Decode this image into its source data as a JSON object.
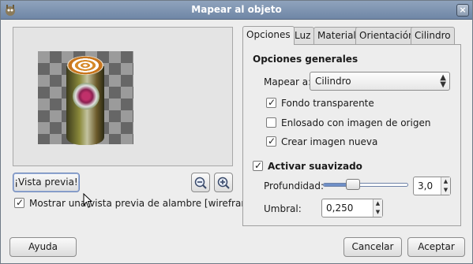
{
  "window": {
    "title": "Mapear al objeto",
    "close_glyph": "×"
  },
  "preview": {
    "button_label": "¡Vista previa!",
    "wireframe_checkbox": {
      "label": "Mostrar una vista previa de alambre [wireframe]",
      "checked": true
    },
    "zoom_out_icon": "zoom-out-icon",
    "zoom_in_icon": "zoom-in-icon"
  },
  "tabs": [
    {
      "label": "Opciones",
      "active": true
    },
    {
      "label": "Luz"
    },
    {
      "label": "Material"
    },
    {
      "label": "Orientación"
    },
    {
      "label": "Cilindro"
    }
  ],
  "options": {
    "general_title": "Opciones generales",
    "map_label": "Mapear a:",
    "map_value": "Cilindro",
    "transparent_bg": {
      "label": "Fondo transparente",
      "checked": true
    },
    "tile_source": {
      "label": "Enlosado con imagen de origen",
      "checked": false
    },
    "new_image": {
      "label": "Crear imagen nueva",
      "checked": true
    },
    "antialias": {
      "label": "Activar suavizado",
      "checked": true
    },
    "depth_label": "Profundidad:",
    "depth_value": "3,0",
    "depth_fraction": 0.35,
    "threshold_label": "Umbral:",
    "threshold_value": "0,250"
  },
  "buttons": {
    "help": "Ayuda",
    "cancel": "Cancelar",
    "accept": "Aceptar"
  },
  "colors": {
    "titlebar": "#7b90ae",
    "slider_fill": "#6f8fc7",
    "dialog_bg": "#ededed"
  }
}
